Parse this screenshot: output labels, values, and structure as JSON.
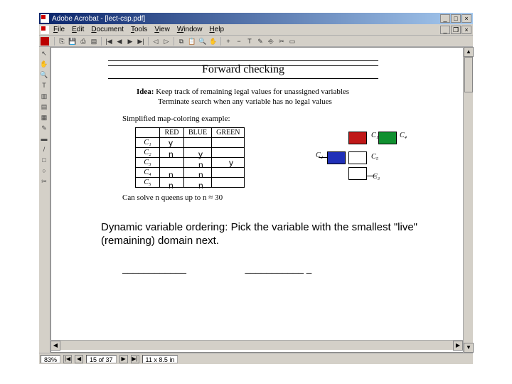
{
  "titlebar": {
    "title": "Adobe Acrobat - [lect-csp.pdf]",
    "min": "_",
    "max": "□",
    "close": "×"
  },
  "menubar": {
    "file": "File",
    "edit": "Edit",
    "document": "Document",
    "tools": "Tools",
    "view": "View",
    "window": "Window",
    "help": "Help",
    "doc_min": "_",
    "doc_restore": "❐",
    "doc_close": "×"
  },
  "toolbar": {
    "open": "⎘",
    "save": "💾",
    "print": "⎙",
    "showhide": "▤",
    "first": "|◀",
    "prev": "◀",
    "next": "▶",
    "last": "▶|",
    "back": "◁",
    "fwd": "▷",
    "copy": "⧉",
    "paste": "📋",
    "find": "🔍",
    "hand": "✋",
    "zoomin": "+",
    "zoomout": "−",
    "selecttext": "T",
    "note": "✎",
    "link": "⎆",
    "crop": "✂",
    "form": "▭"
  },
  "lefttools": {
    "arrow": "↖",
    "hand": "✋",
    "zoom": "🔍",
    "text": "T",
    "column": "▥",
    "note": "▤",
    "stamp": "▦",
    "pencil": "✎",
    "highlight": "▬",
    "line": "/",
    "box": "□",
    "circle": "○",
    "crop": "✂"
  },
  "slide": {
    "title": "Forward checking",
    "idea_label": "Idea:",
    "idea_line1": "Keep track of remaining legal values for unassigned variables",
    "idea_line2": "Terminate search when any variable has no legal values",
    "example_label": "Simplified map-coloring example:",
    "table": {
      "headers": [
        "",
        "RED",
        "BLUE",
        "GREEN"
      ],
      "rows": [
        {
          "label": "C₁",
          "cells": [
            "",
            "",
            ""
          ]
        },
        {
          "label": "C₂",
          "cells": [
            "",
            "",
            ""
          ]
        },
        {
          "label": "C₃",
          "cells": [
            "",
            "",
            ""
          ]
        },
        {
          "label": "C₄",
          "cells": [
            "",
            "",
            ""
          ]
        },
        {
          "label": "C₅",
          "cells": [
            "",
            "",
            ""
          ]
        }
      ]
    },
    "overlay": {
      "r1_red": "y",
      "r2_red": "n",
      "r2_blue": "y",
      "r3_blue": "n",
      "r3_green": "y",
      "r4_red": "n",
      "r4_blue": "n",
      "r5_red": "n",
      "r5_blue": "n"
    },
    "diagram": {
      "c1": "C₁",
      "c2": "C₂",
      "c3": "C₃",
      "c4": "C₄",
      "c5": "C₅",
      "colors": {
        "c1": "#c01818",
        "c2": "#2030b8",
        "c4": "#109030"
      }
    },
    "nqueens": "Can solve n queens up to n ≈ 30",
    "dynamic": "Dynamic variable ordering: Pick the variable with the smallest \"live\" (remaining) domain next.",
    "blank1": "____________",
    "blank2": "___________  _"
  },
  "statusbar": {
    "zoom": "83%",
    "first": "|◀",
    "prev": "◀",
    "page": "15 of 37",
    "next": "▶",
    "last": "▶|",
    "size": "11 x 8.5 in"
  },
  "scrollbar": {
    "up": "▲",
    "down": "▼",
    "left": "◀",
    "right": "▶"
  }
}
